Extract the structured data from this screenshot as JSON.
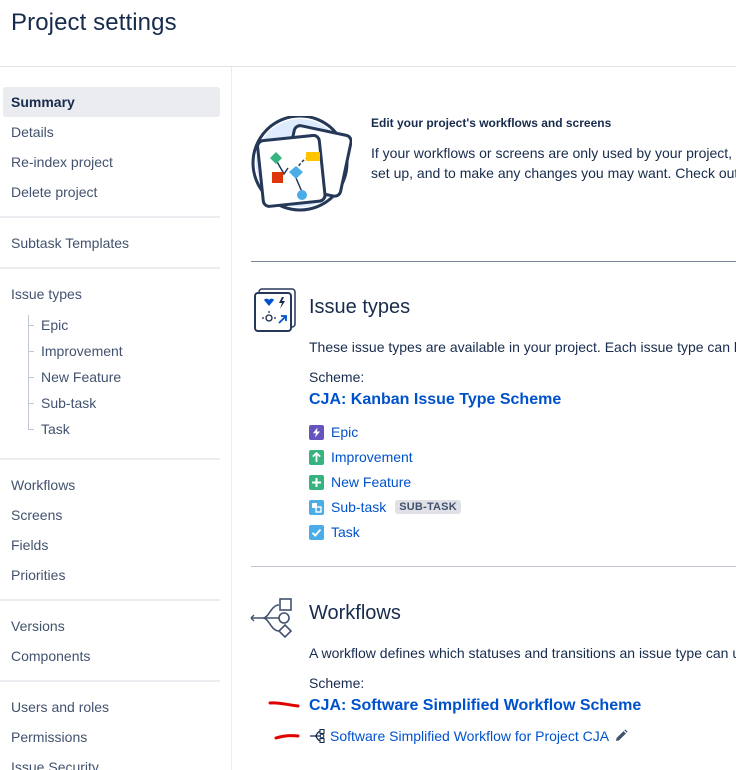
{
  "page": {
    "title": "Project settings"
  },
  "sidebar": {
    "group1": [
      "Summary",
      "Details",
      "Re-index project",
      "Delete project"
    ],
    "subtask_templates": "Subtask Templates",
    "issue_types_label": "Issue types",
    "issue_types_children": [
      "Epic",
      "Improvement",
      "New Feature",
      "Sub-task",
      "Task"
    ],
    "group3": [
      "Workflows",
      "Screens",
      "Fields",
      "Priorities"
    ],
    "group4": [
      "Versions",
      "Components"
    ],
    "group5": [
      "Users and roles",
      "Permissions",
      "Issue Security"
    ],
    "active": "Summary"
  },
  "intro": {
    "title": "Edit your project's workflows and screens",
    "line1": "If your workflows or screens are only used by your project, y",
    "line2": "set up, and to make any changes you may want. Check out"
  },
  "issue_types": {
    "title": "Issue types",
    "description": "These issue types are available in your project. Each issue type can be",
    "scheme_label": "Scheme:",
    "scheme_name": "CJA: Kanban Issue Type Scheme",
    "items": [
      {
        "label": "Epic",
        "icon": "epic-icon",
        "color": "#6554c0"
      },
      {
        "label": "Improvement",
        "icon": "improvement-icon",
        "color": "#36b37e"
      },
      {
        "label": "New Feature",
        "icon": "new-feature-icon",
        "color": "#36b37e"
      },
      {
        "label": "Sub-task",
        "icon": "subtask-icon",
        "color": "#4bade8",
        "lozenge": "SUB-TASK"
      },
      {
        "label": "Task",
        "icon": "task-icon",
        "color": "#4bade8"
      }
    ]
  },
  "workflows": {
    "title": "Workflows",
    "description": "A workflow defines which statuses and transitions an issue type can u",
    "scheme_label": "Scheme:",
    "scheme_name": "CJA: Software Simplified Workflow Scheme",
    "workflow_name": "Software Simplified Workflow for Project CJA"
  },
  "colors": {
    "link": "#0052cc",
    "text": "#172b4d",
    "sidebar_text": "#42526e",
    "active_bg": "#ebecf0",
    "annotation": "#e00000"
  }
}
